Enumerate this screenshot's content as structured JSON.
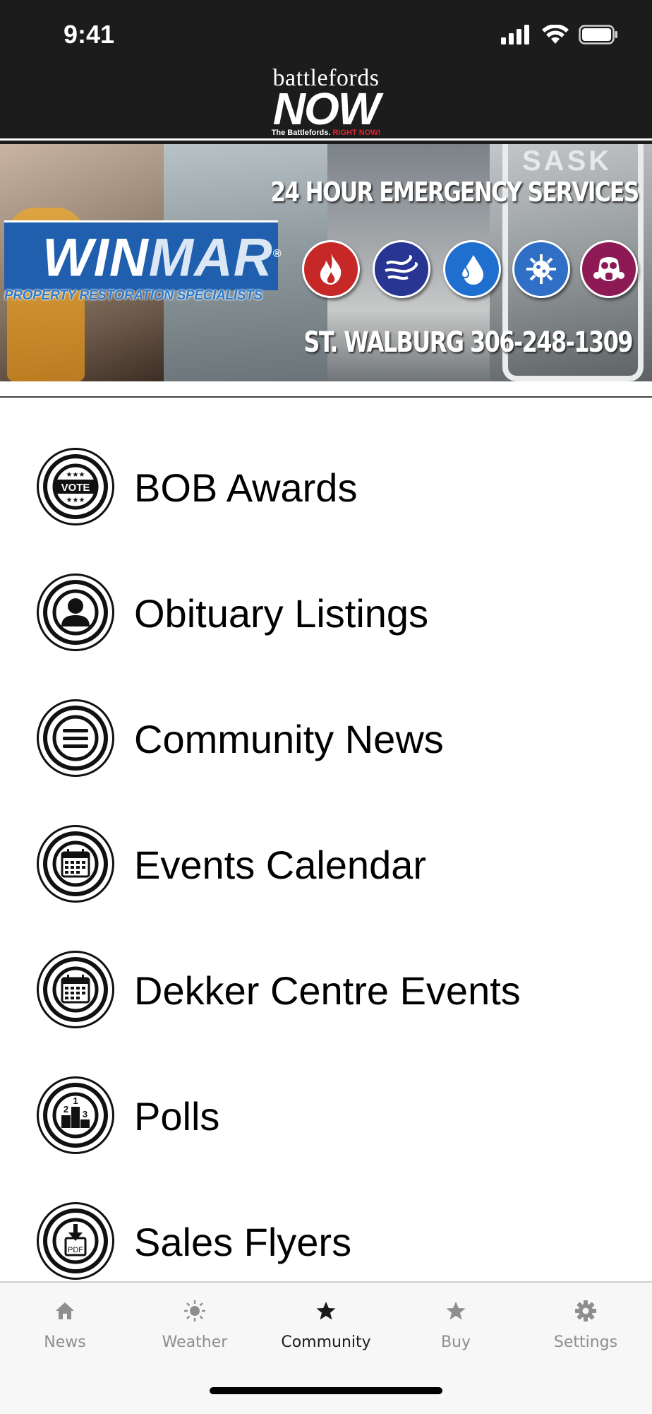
{
  "status": {
    "time": "9:41"
  },
  "header": {
    "logo_top": "battlefords",
    "logo_main": "NOW",
    "logo_tagline": "The Battlefords.",
    "logo_tagline_red": "RIGHT NOW!"
  },
  "banner": {
    "brand_win": "WIN",
    "brand_mar": "MAR",
    "brand_reg": "®",
    "brand_sub": "PROPERTY RESTORATION SPECIALISTS",
    "headline": "24 HOUR EMERGENCY SERVICES",
    "phone": "ST. WALBURG 306-248-1309",
    "sign_text": "SASK",
    "service_icons": [
      {
        "name": "fire-icon",
        "color": "#c62828"
      },
      {
        "name": "wind-icon",
        "color": "#283593"
      },
      {
        "name": "water-drop-icon",
        "color": "#1e6fd0"
      },
      {
        "name": "mold-icon",
        "color": "#2f6fc6"
      },
      {
        "name": "gas-mask-icon",
        "color": "#8e1a55"
      }
    ]
  },
  "menu": {
    "items": [
      {
        "label": "BOB Awards",
        "icon": "vote-icon"
      },
      {
        "label": "Obituary Listings",
        "icon": "person-icon"
      },
      {
        "label": "Community News",
        "icon": "menu-lines-icon"
      },
      {
        "label": "Events Calendar",
        "icon": "calendar-icon"
      },
      {
        "label": "Dekker Centre Events",
        "icon": "calendar-icon"
      },
      {
        "label": "Polls",
        "icon": "podium-icon"
      },
      {
        "label": "Sales Flyers",
        "icon": "pdf-download-icon"
      }
    ],
    "vote_text": "VOTE",
    "pdf_text": "PDF",
    "podium_numbers": [
      "2",
      "1",
      "3"
    ]
  },
  "tabbar": {
    "tabs": [
      {
        "label": "News",
        "icon": "home-icon",
        "active": false
      },
      {
        "label": "Weather",
        "icon": "sun-icon",
        "active": false
      },
      {
        "label": "Community",
        "icon": "star-icon",
        "active": true
      },
      {
        "label": "Buy",
        "icon": "star-icon",
        "active": false
      },
      {
        "label": "Settings",
        "icon": "gear-icon",
        "active": false
      }
    ]
  },
  "colors": {
    "header_bg": "#1c1c1c",
    "accent_red": "#e2262e",
    "winmar_blue": "#1f5fae",
    "tab_inactive": "#8e8e8e",
    "tab_active": "#1a1a1a"
  }
}
